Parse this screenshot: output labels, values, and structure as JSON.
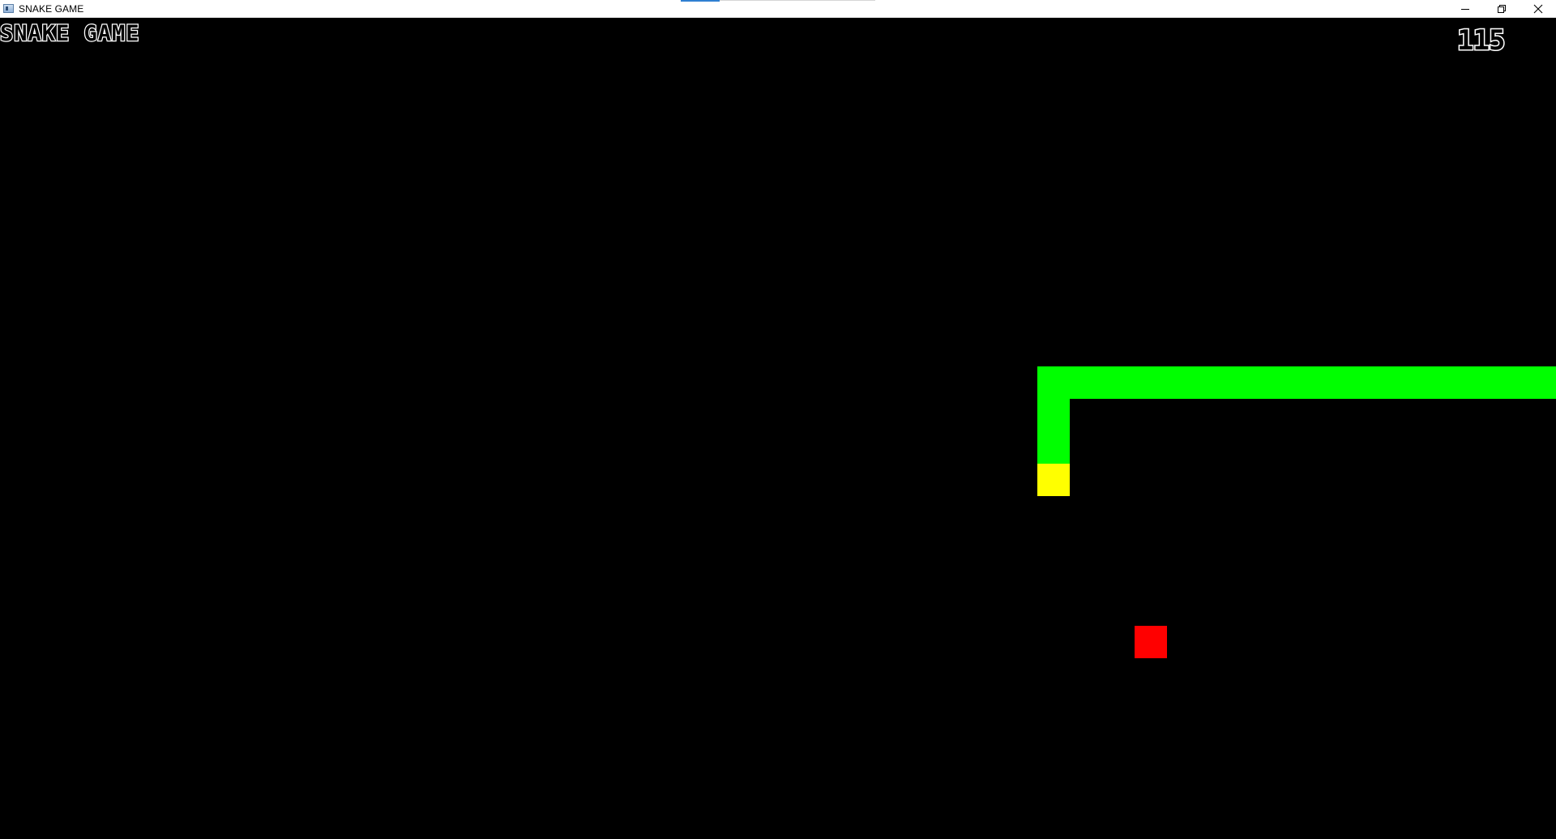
{
  "window": {
    "title": "SNAKE GAME",
    "icon": "app-window-icon",
    "controls": [
      "minimize-icon",
      "restore-icon",
      "close-icon"
    ]
  },
  "hud": {
    "title": "SNAKE GAME",
    "score": "115"
  },
  "colors": {
    "background": "#000000",
    "snake_body": "#00ff00",
    "snake_head": "#ffff00",
    "food": "#ff0000",
    "hud_text": "#ffffff"
  },
  "game": {
    "grid_cell": 40,
    "snake": [
      {
        "col": 16,
        "row": 3,
        "part": "head"
      },
      {
        "col": 16,
        "row": 2,
        "part": "body"
      },
      {
        "col": 16,
        "row": 1,
        "part": "body"
      },
      {
        "col": 16,
        "row": 0,
        "part": "body"
      },
      {
        "col": 17,
        "row": 0,
        "part": "body"
      },
      {
        "col": 18,
        "row": 0,
        "part": "body"
      },
      {
        "col": 19,
        "row": 0,
        "part": "body"
      },
      {
        "col": 20,
        "row": 0,
        "part": "body"
      },
      {
        "col": 21,
        "row": 0,
        "part": "body"
      },
      {
        "col": 22,
        "row": 0,
        "part": "body"
      },
      {
        "col": 23,
        "row": 0,
        "part": "body"
      },
      {
        "col": 24,
        "row": 0,
        "part": "body"
      },
      {
        "col": 25,
        "row": 0,
        "part": "body"
      },
      {
        "col": 26,
        "row": 0,
        "part": "body"
      },
      {
        "col": 27,
        "row": 0,
        "part": "body"
      },
      {
        "col": 28,
        "row": 0,
        "part": "body"
      },
      {
        "col": 29,
        "row": 0,
        "part": "body"
      },
      {
        "col": 30,
        "row": 0,
        "part": "body"
      },
      {
        "col": 31,
        "row": 0,
        "part": "body"
      },
      {
        "col": 32,
        "row": 0,
        "part": "body"
      }
    ],
    "food": {
      "col": 19,
      "row": 8
    }
  }
}
